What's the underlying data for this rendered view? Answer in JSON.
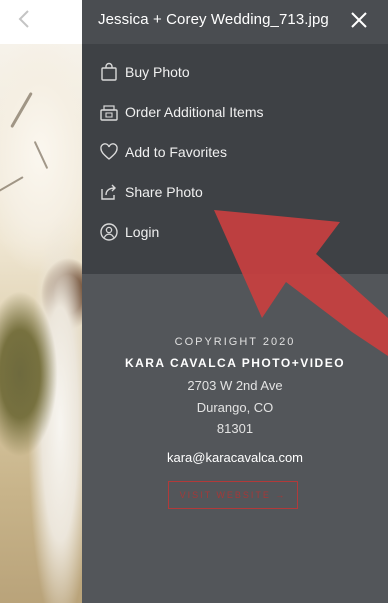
{
  "header": {
    "title": "Jessica + Corey Wedding_713.jpg"
  },
  "menu": {
    "items": [
      {
        "label": "Buy Photo",
        "icon": "shopping-bag-icon"
      },
      {
        "label": "Order Additional Items",
        "icon": "gift-box-icon"
      },
      {
        "label": "Add to Favorites",
        "icon": "heart-icon"
      },
      {
        "label": "Share Photo",
        "icon": "share-icon"
      },
      {
        "label": "Login",
        "icon": "user-icon"
      }
    ]
  },
  "footer": {
    "copyright": "COPYRIGHT 2020",
    "company": "KARA CAVALCA PHOTO+VIDEO",
    "address_line1": "2703 W 2nd Ave",
    "address_line2": "Durango, CO",
    "address_line3": "81301",
    "email": "kara@karacavalca.com",
    "visit_label": "VISIT WEBSITE →"
  },
  "colors": {
    "panel": "#53565a",
    "menu": "#3e4145",
    "accent_red": "#c83c3c"
  }
}
